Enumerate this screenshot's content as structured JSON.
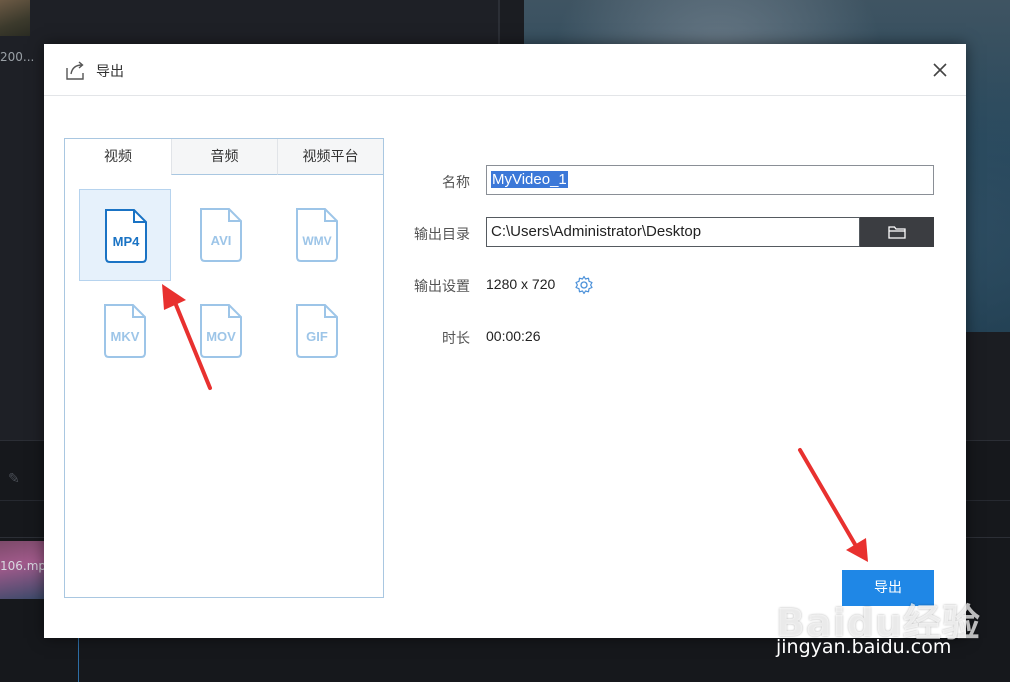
{
  "background_app": {
    "thumb_caption": "200...",
    "clip_name": "106.mp"
  },
  "dialog": {
    "title": "导出",
    "close_icon": "close-icon",
    "tabs": [
      {
        "label": "视频",
        "active": true
      },
      {
        "label": "音频",
        "active": false
      },
      {
        "label": "视频平台",
        "active": false
      }
    ],
    "formats": [
      {
        "label": "MP4",
        "selected": true
      },
      {
        "label": "AVI",
        "selected": false
      },
      {
        "label": "WMV",
        "selected": false
      },
      {
        "label": "MKV",
        "selected": false
      },
      {
        "label": "MOV",
        "selected": false
      },
      {
        "label": "GIF",
        "selected": false
      }
    ],
    "fields": {
      "name_label": "名称",
      "name_value": "MyVideo_1",
      "dir_label": "输出目录",
      "dir_value": "C:\\Users\\Administrator\\Desktop",
      "settings_label": "输出设置",
      "settings_value": "1280 x 720",
      "duration_label": "时长",
      "duration_value": "00:00:26"
    },
    "export_label": "导出"
  },
  "watermark": {
    "logo": "Baidu经验",
    "url": "jingyan.baidu.com"
  },
  "colors": {
    "accent": "#1f87e6",
    "format_icon_active": "#1a73c4",
    "format_icon_inactive": "#9dc5e8",
    "annotation_red": "#e8312f"
  }
}
